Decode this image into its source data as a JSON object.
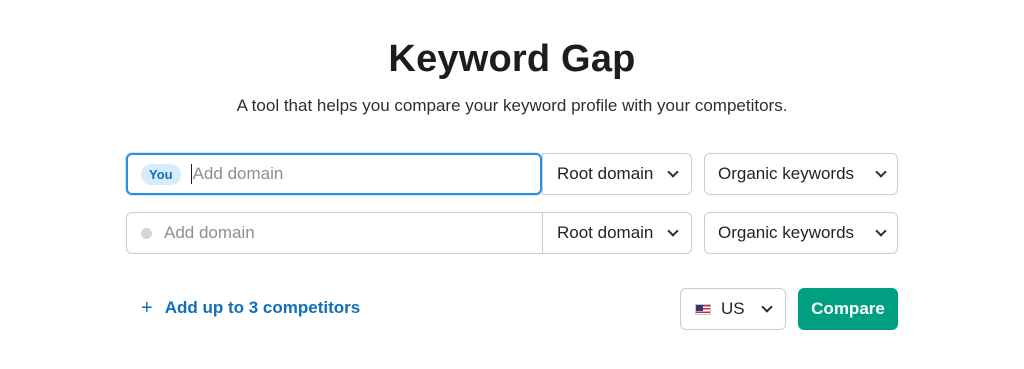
{
  "header": {
    "title": "Keyword Gap",
    "subtitle": "A tool that helps you compare your keyword profile with your competitors."
  },
  "rows": [
    {
      "badge": "You",
      "placeholder": "Add domain",
      "value": "",
      "scope": "Root domain",
      "keyword_type": "Organic keywords",
      "focused": true
    },
    {
      "placeholder": "Add domain",
      "value": "",
      "scope": "Root domain",
      "keyword_type": "Organic keywords",
      "focused": false
    }
  ],
  "footer": {
    "add_competitors_label": "Add up to 3 competitors",
    "plus_icon": "+",
    "country": "US",
    "country_flag_icon": "us-flag-icon",
    "compare_label": "Compare"
  },
  "colors": {
    "accent": "#009f81",
    "link": "#116fb8",
    "focus_border": "#2b8fe0",
    "badge_bg": "#d6ecfb"
  }
}
